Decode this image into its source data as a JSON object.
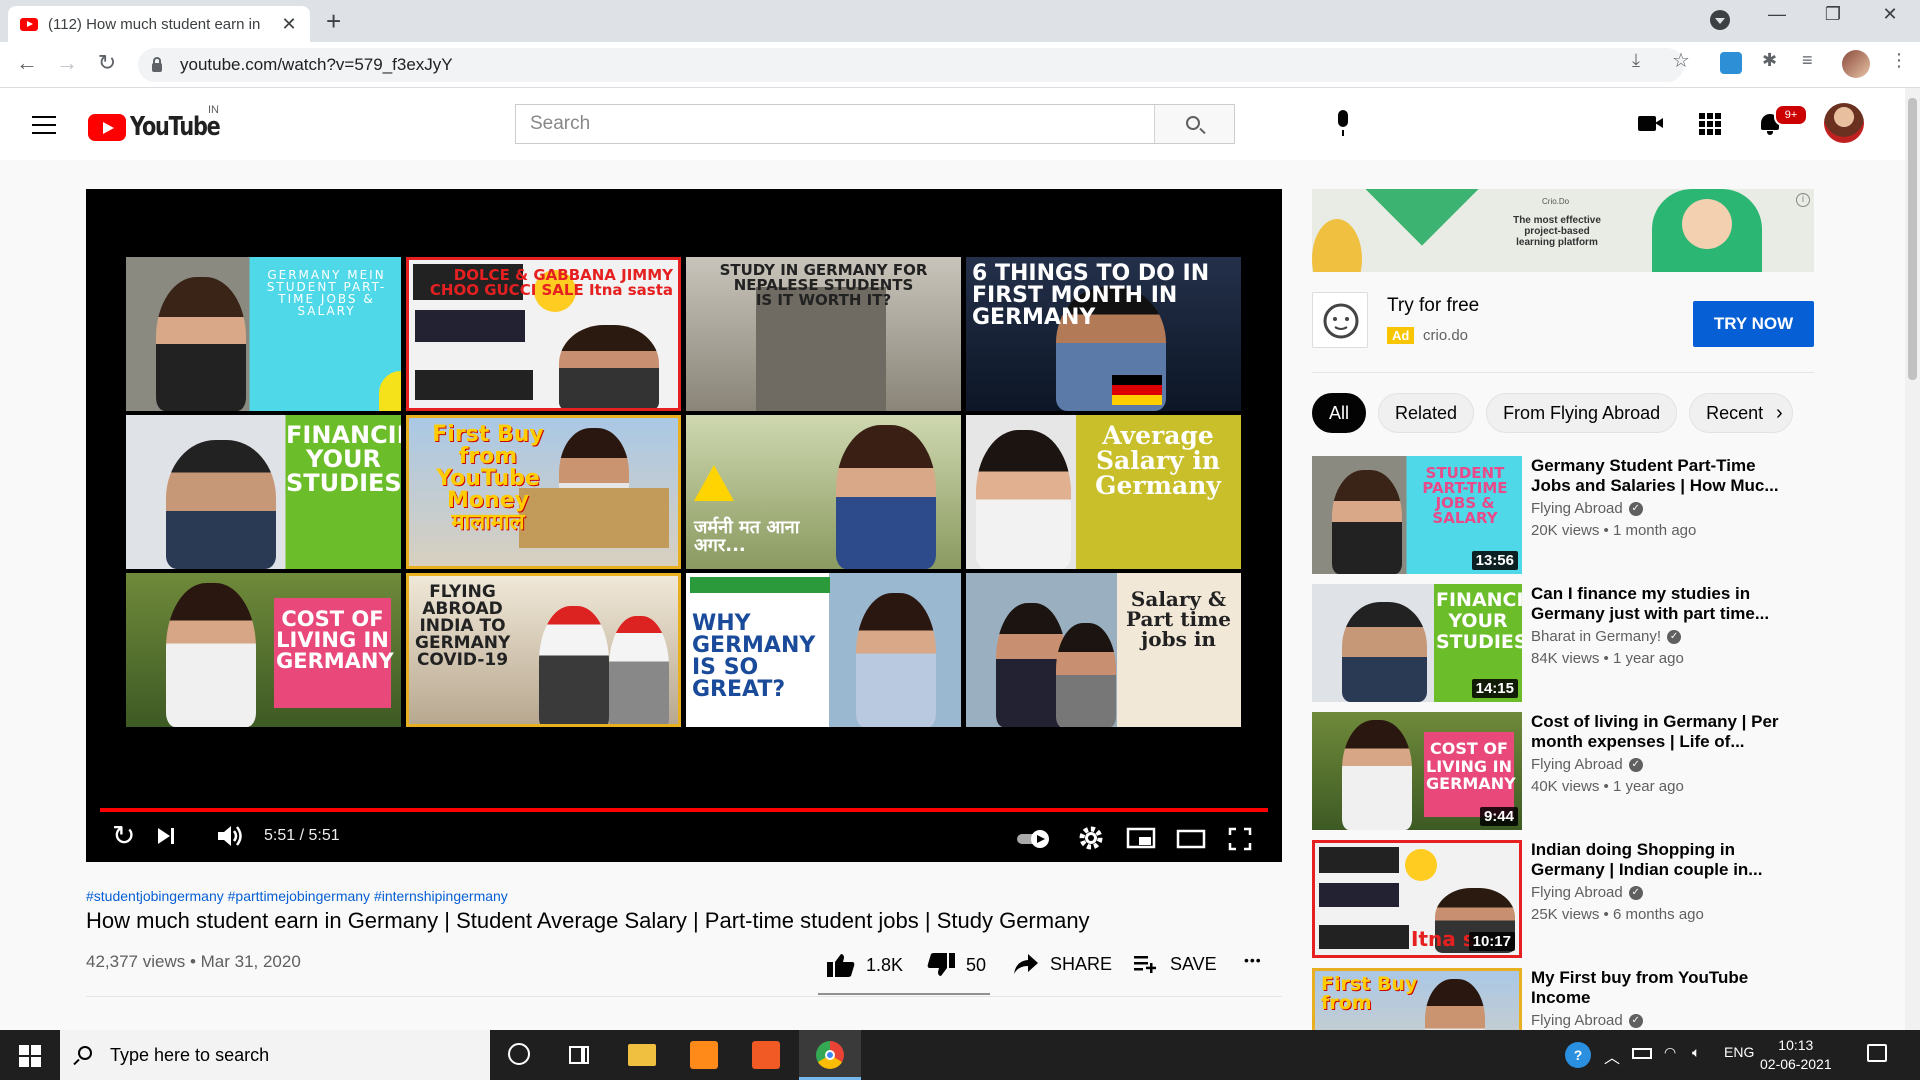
{
  "browser": {
    "tab_title": "(112) How much student earn in",
    "url": "youtube.com/watch?v=579_f3exJyY",
    "tab_close": "✕",
    "new_tab": "+",
    "back": "←",
    "forward": "→",
    "reload": "↻",
    "minimize": "—",
    "maximize": "❐",
    "close": "✕",
    "download_icon": "⤓",
    "star_icon": "☆",
    "puzzle_icon": "✱",
    "media_icon": "≡"
  },
  "youtube": {
    "logo_text": "YouTube",
    "country": "IN",
    "search_placeholder": "Search",
    "notification_count": "9+"
  },
  "player": {
    "time": "5:51 / 5:51",
    "progress": 1.0,
    "thumbnails": [
      "GERMANY MEIN\nSTUDENT PART-TIME JOBS & SALARY",
      "DOLCE & GABBANA  JIMMY CHOO  GUCCI  SALE  Itna sasta",
      "STUDY IN GERMANY FOR NEPALESE STUDENTS\nIS IT WORTH IT?",
      "6 THINGS TO DO IN FIRST MONTH IN GERMANY",
      "FINANCING YOUR STUDIES",
      "First Buy from YouTube Money मालामाल",
      "जर्मनी मत आना अगर...",
      "Average Salary in Germany",
      "COST OF LIVING IN GERMANY",
      "FLYING ABROAD INDIA TO GERMANY COVID-19",
      "WHY GERMANY IS SO GREAT?",
      "Salary & Part time jobs in"
    ]
  },
  "video": {
    "hashtags": "#studentjobingermany #parttimejobingermany #internshipingermany",
    "title": "How much student earn in Germany | Student Average Salary | Part-time student jobs | Study Germany",
    "views_date": "42,377 views • Mar 31, 2020",
    "likes": "1.8K",
    "dislikes": "50",
    "share": "SHARE",
    "save": "SAVE",
    "more": "•••"
  },
  "ad": {
    "banner_text": "The most effective project-based learning platform",
    "banner_brand": "Crio.Do",
    "title": "Try for free",
    "tag": "Ad",
    "domain": "crio.do",
    "button": "TRY NOW"
  },
  "chips": [
    "All",
    "Related",
    "From Flying Abroad",
    "Recent"
  ],
  "recommendations": [
    {
      "title": "Germany Student Part-Time Jobs and Salaries | How Muc...",
      "channel": "Flying Abroad",
      "meta": "20K views • 1 month ago",
      "duration": "13:56"
    },
    {
      "title": "Can I finance my studies in Germany just with part time...",
      "channel": "Bharat in Germany!",
      "meta": "84K views • 1 year ago",
      "duration": "14:15"
    },
    {
      "title": "Cost of living in Germany | Per month expenses | Life of...",
      "channel": "Flying Abroad",
      "meta": "40K views • 1 year ago",
      "duration": "9:44"
    },
    {
      "title": "Indian doing Shopping in Germany | Indian couple in...",
      "channel": "Flying Abroad",
      "meta": "25K views • 6 months ago",
      "duration": "10:17"
    },
    {
      "title": "My First buy from YouTube Income",
      "channel": "Flying Abroad",
      "meta": "",
      "duration": ""
    }
  ],
  "taskbar": {
    "search_text": "Type here to search",
    "lang": "ENG",
    "time": "10:13",
    "date": "02-06-2021"
  }
}
